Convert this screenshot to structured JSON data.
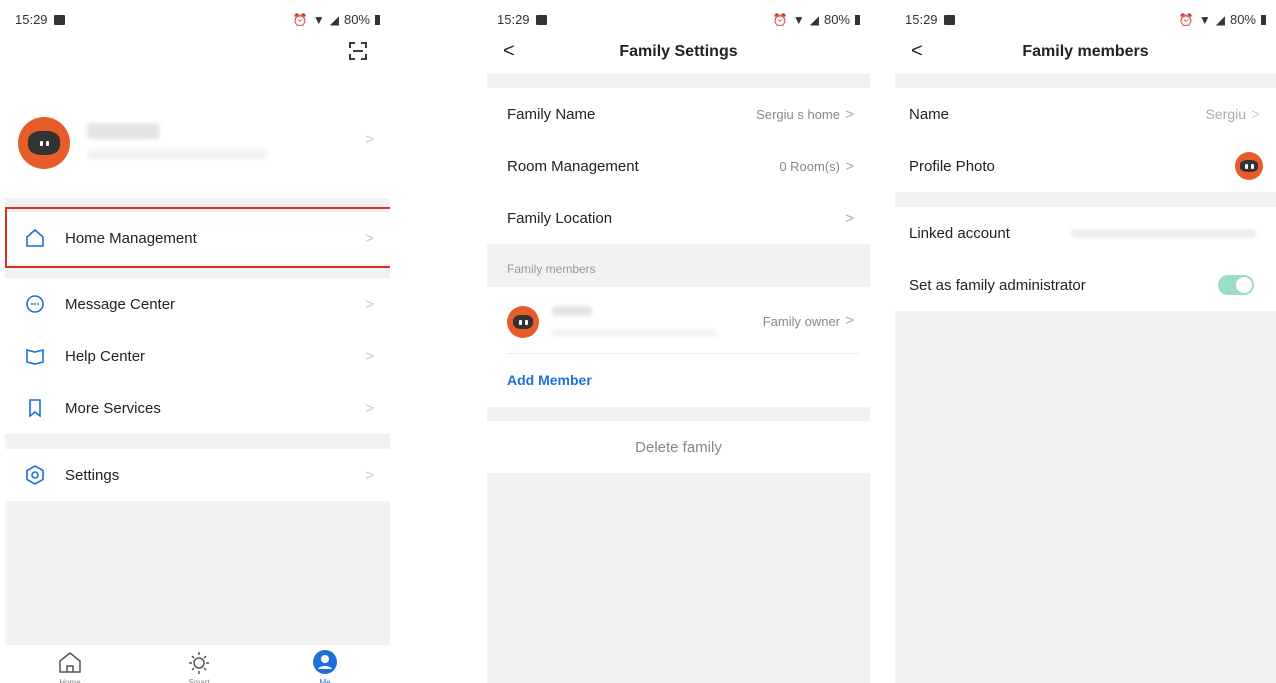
{
  "status_bar": {
    "time": "15:29",
    "battery": "80%"
  },
  "panel1": {
    "menu": [
      {
        "label": "Home Management",
        "icon": "home-outline-icon"
      },
      {
        "label": "Message Center",
        "icon": "chat-bubble-icon"
      },
      {
        "label": "Help Center",
        "icon": "book-icon"
      },
      {
        "label": "More Services",
        "icon": "bookmark-icon"
      },
      {
        "label": "Settings",
        "icon": "hexagon-gear-icon"
      }
    ],
    "tabs": [
      {
        "label": "Home",
        "icon": "home-tab-icon"
      },
      {
        "label": "Smart",
        "icon": "sun-icon"
      },
      {
        "label": "Me",
        "icon": "person-icon"
      }
    ],
    "accent": "#1e6fd9"
  },
  "panel2": {
    "title": "Family Settings",
    "rows": [
      {
        "label": "Family Name",
        "value": "Sergiu s home"
      },
      {
        "label": "Room Management",
        "value": "0 Room(s)"
      },
      {
        "label": "Family Location",
        "value": ""
      }
    ],
    "members_section": "Family members",
    "member_role": "Family owner",
    "add_member": "Add Member",
    "delete": "Delete family"
  },
  "panel3": {
    "title": "Family members",
    "rows": [
      {
        "label": "Name",
        "value": "Sergiu"
      },
      {
        "label": "Profile Photo"
      },
      {
        "label": "Linked account"
      },
      {
        "label": "Set as family administrator"
      }
    ]
  }
}
